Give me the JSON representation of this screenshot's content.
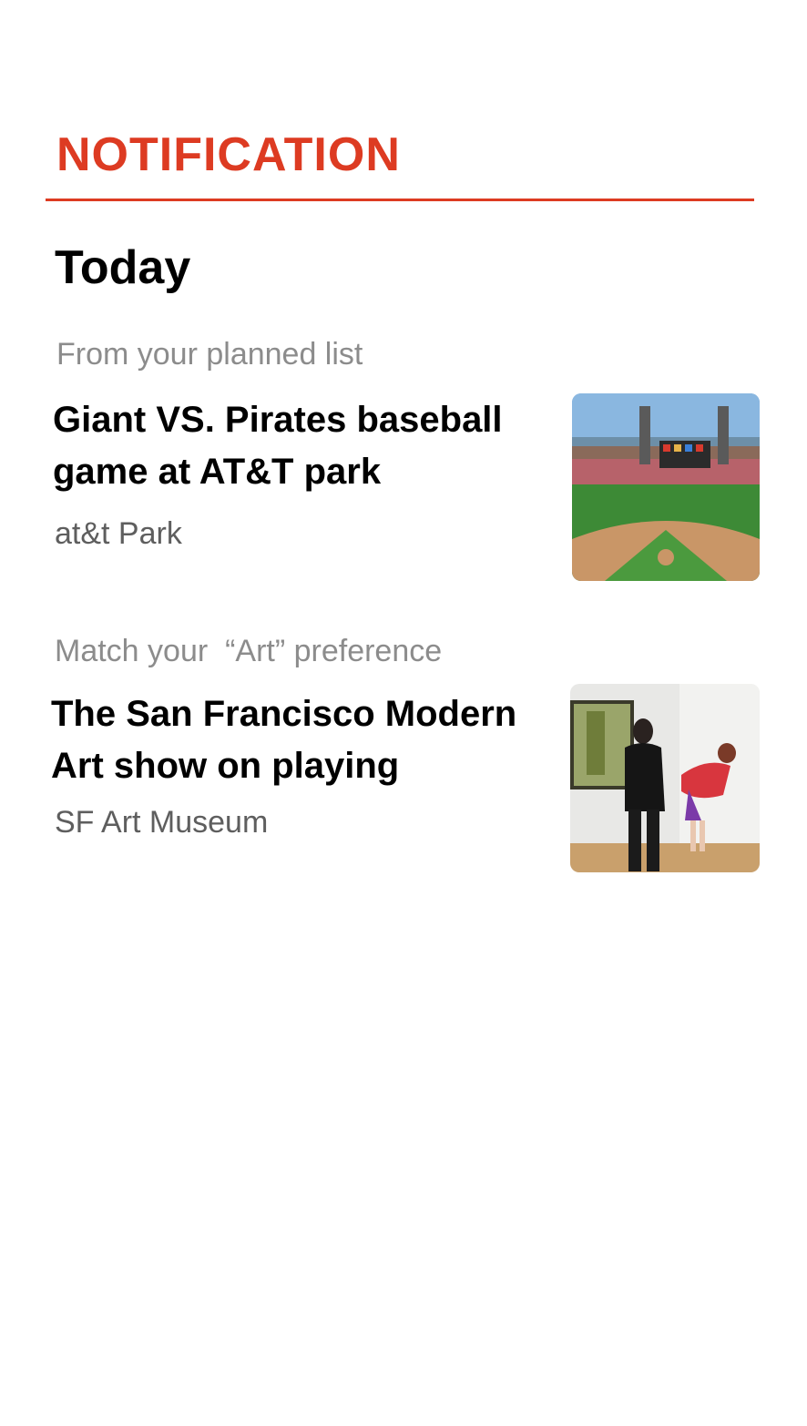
{
  "header": {
    "title": "NOTIFICATION",
    "accent_color": "#dd3b22"
  },
  "section": {
    "heading": "Today"
  },
  "notifications": [
    {
      "context": "From your planned list",
      "title": "Giant VS. Pirates baseball game at AT&T park",
      "location": "at&t Park",
      "thumbnail": "baseball-stadium-photo"
    },
    {
      "context": "Match your  “Art” preference",
      "title": "The San Francisco Modern Art show on playing",
      "location": "SF Art Museum",
      "thumbnail": "art-museum-photo"
    }
  ]
}
